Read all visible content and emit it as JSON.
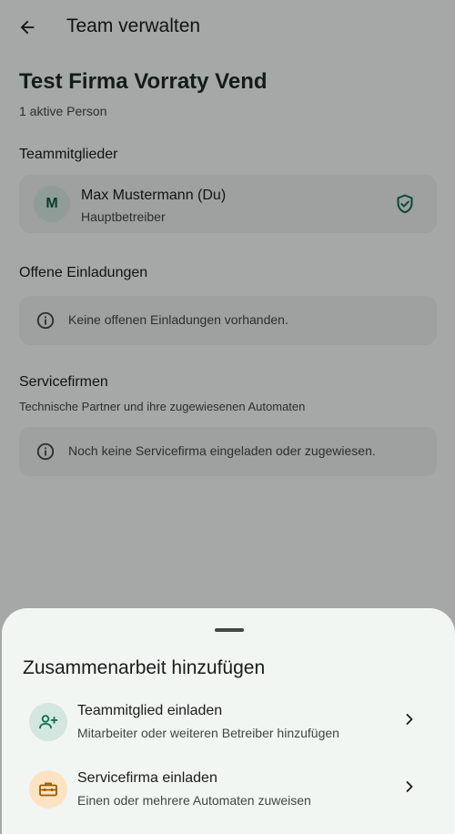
{
  "appbar": {
    "title": "Team verwalten",
    "back_icon": "arrow-back-icon"
  },
  "organization": {
    "name": "Test Firma Vorraty Vend",
    "active_count": "1 aktive Person"
  },
  "members": {
    "title": "Teammitglieder",
    "items": [
      {
        "initial": "M",
        "name": "Max Mustermann (Du)",
        "role": "Hauptbetreiber",
        "badge_icon": "verified-shield-icon"
      }
    ]
  },
  "invitations": {
    "title": "Offene Einladungen",
    "empty_text": "Keine offenen Einladungen vorhanden."
  },
  "service_companies": {
    "title": "Servicefirmen",
    "subtitle": "Technische Partner und ihre zugewiesenen Automaten",
    "empty_text": "Noch keine Servicefirma eingeladen oder zugewiesen."
  },
  "sheet": {
    "title": "Zusammenarbeit hinzufügen",
    "options": [
      {
        "title": "Teammitglied einladen",
        "subtitle": "Mitarbeiter oder weiteren Betreiber hinzufügen",
        "icon": "person-add-icon"
      },
      {
        "title": "Servicefirma einladen",
        "subtitle": "Einen oder mehrere Automaten zuweisen",
        "icon": "toolbox-icon"
      }
    ]
  },
  "colors": {
    "primary": "#0f6b55",
    "surface": "#f4f8f6",
    "card": "#e9eeeb",
    "member_icon_bg": "#d3e6df",
    "service_icon_bg": "#fde3c4",
    "service_icon": "#9a5a00"
  }
}
